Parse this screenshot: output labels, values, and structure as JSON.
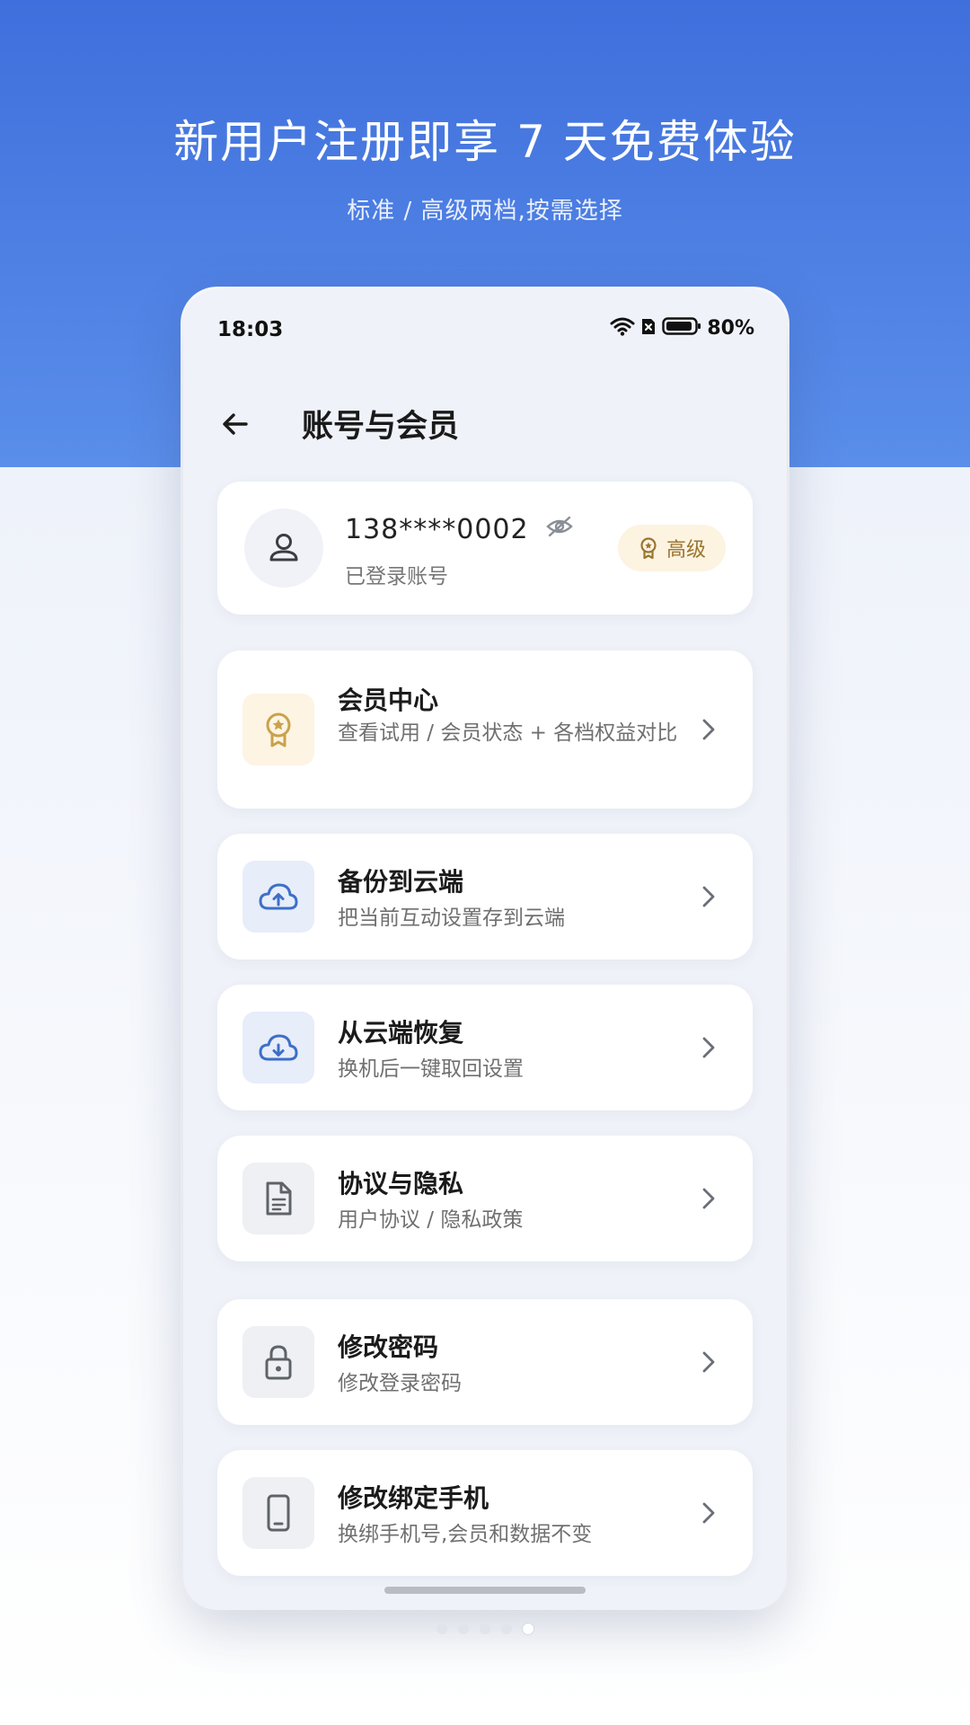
{
  "banner": {
    "headline": "新用户注册即享 7 天免费体验",
    "subhead": "标准 / 高级两档,按需选择"
  },
  "status_bar": {
    "time": "18:03",
    "battery": "80%",
    "icons": [
      "wifi-icon",
      "sim-blocked-icon",
      "battery-icon"
    ]
  },
  "app_bar": {
    "title": "账号与会员",
    "back_icon": "arrow-left-icon"
  },
  "profile": {
    "phone": "138****0002",
    "status": "已登录账号",
    "tier": "高级",
    "avatar_icon": "person-icon",
    "visibility_icon": "eye-off-icon",
    "tier_icon": "award-icon"
  },
  "menu": [
    {
      "title": "会员中心",
      "desc": "查看试用 / 会员状态 + 各档权益对比",
      "icon": "award-icon"
    },
    {
      "title": "备份到云端",
      "desc": "把当前互动设置存到云端",
      "icon": "cloud-upload-icon"
    },
    {
      "title": "从云端恢复",
      "desc": "换机后一键取回设置",
      "icon": "cloud-download-icon"
    },
    {
      "title": "协议与隐私",
      "desc": "用户协议 / 隐私政策",
      "icon": "document-icon"
    },
    {
      "title": "修改密码",
      "desc": "修改登录密码",
      "icon": "lock-icon"
    },
    {
      "title": "修改绑定手机",
      "desc": "换绑手机号,会员和数据不变",
      "icon": "smartphone-icon"
    }
  ],
  "colors": {
    "accent": "#3f6fdc",
    "gold": "#c9a24a",
    "cloud_blue": "#3d6fc8",
    "grey_icon": "#5f6368"
  },
  "pagination": {
    "total": 5,
    "active": 5
  }
}
